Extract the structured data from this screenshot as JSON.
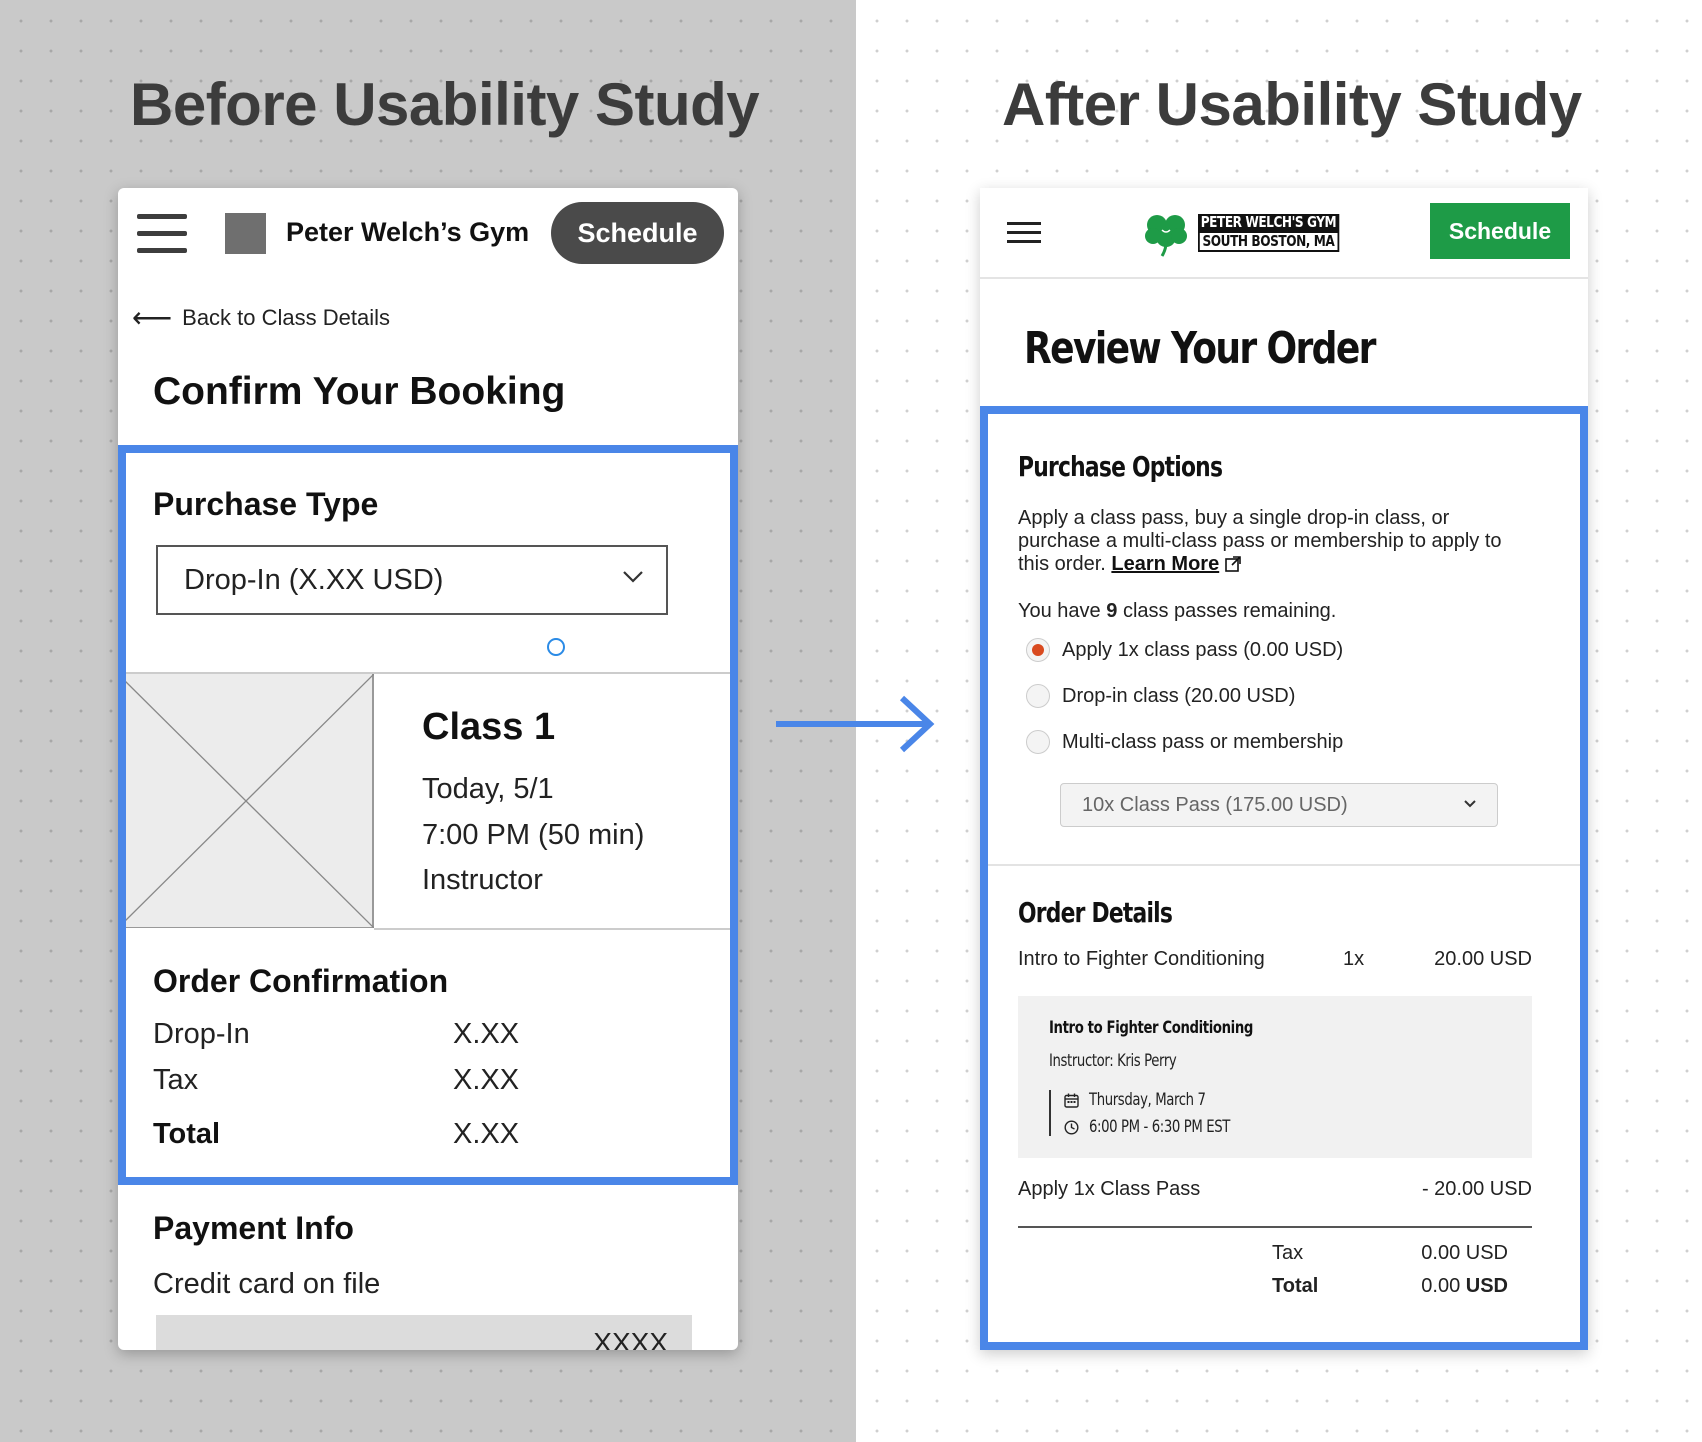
{
  "before": {
    "study_title": "Before Usability Study",
    "header": {
      "gym_name": "Peter Welch’s Gym",
      "schedule_label": "Schedule"
    },
    "back_link": "Back to Class Details",
    "page_title": "Confirm Your Booking",
    "purchase_type": {
      "title": "Purchase Type",
      "selected": "Drop-In (X.XX USD)"
    },
    "class": {
      "name": "Class 1",
      "date": "Today, 5/1",
      "time": "7:00 PM (50 min)",
      "instructor": "Instructor"
    },
    "order": {
      "title": "Order Confirmation",
      "rows": [
        {
          "label": "Drop-In",
          "value": "X.XX"
        },
        {
          "label": "Tax",
          "value": "X.XX"
        },
        {
          "label": "Total",
          "value": "X.XX"
        }
      ]
    },
    "payment": {
      "title": "Payment Info",
      "subtitle": "Credit card on file",
      "card_mask": "XXXX"
    }
  },
  "after": {
    "study_title": "After Usability Study",
    "header": {
      "logo_line1": "PETER WELCH'S GYM",
      "logo_line2": "SOUTH BOSTON, MA",
      "schedule_label": "Schedule"
    },
    "page_title": "Review Your Order",
    "purchase_options": {
      "title": "Purchase Options",
      "description": "Apply a class pass, buy a single drop-in class, or purchase a multi-class pass or membership to apply to this order.",
      "learn_more": "Learn More",
      "passes_prefix": "You have",
      "passes_count": "9",
      "passes_suffix": "class passes remaining.",
      "options": [
        {
          "label": "Apply 1x class pass (0.00 USD)",
          "checked": true
        },
        {
          "label": "Drop-in class (20.00 USD)",
          "checked": false
        },
        {
          "label": "Multi-class pass or membership",
          "checked": false
        }
      ],
      "multi_select_value": "10x Class Pass (175.00 USD)"
    },
    "order_details": {
      "title": "Order Details",
      "item": {
        "name": "Intro to Fighter Conditioning",
        "qty": "1x",
        "price": "20.00 USD"
      },
      "card": {
        "title": "Intro to Fighter Conditioning",
        "instructor": "Instructor: Kris Perry",
        "date": "Thursday, March 7",
        "time": "6:00 PM - 6:30 PM EST"
      },
      "discount": {
        "label": "Apply 1x Class Pass",
        "value": "- 20.00 USD"
      },
      "tax": {
        "label": "Tax",
        "value": "0.00 USD"
      },
      "total": {
        "label": "Total",
        "amount": "0.00",
        "currency": "USD"
      }
    },
    "colors": {
      "accent_green": "#1e9b47",
      "highlight_blue": "#4a86e8",
      "radio_selected": "#d94a1f"
    }
  }
}
